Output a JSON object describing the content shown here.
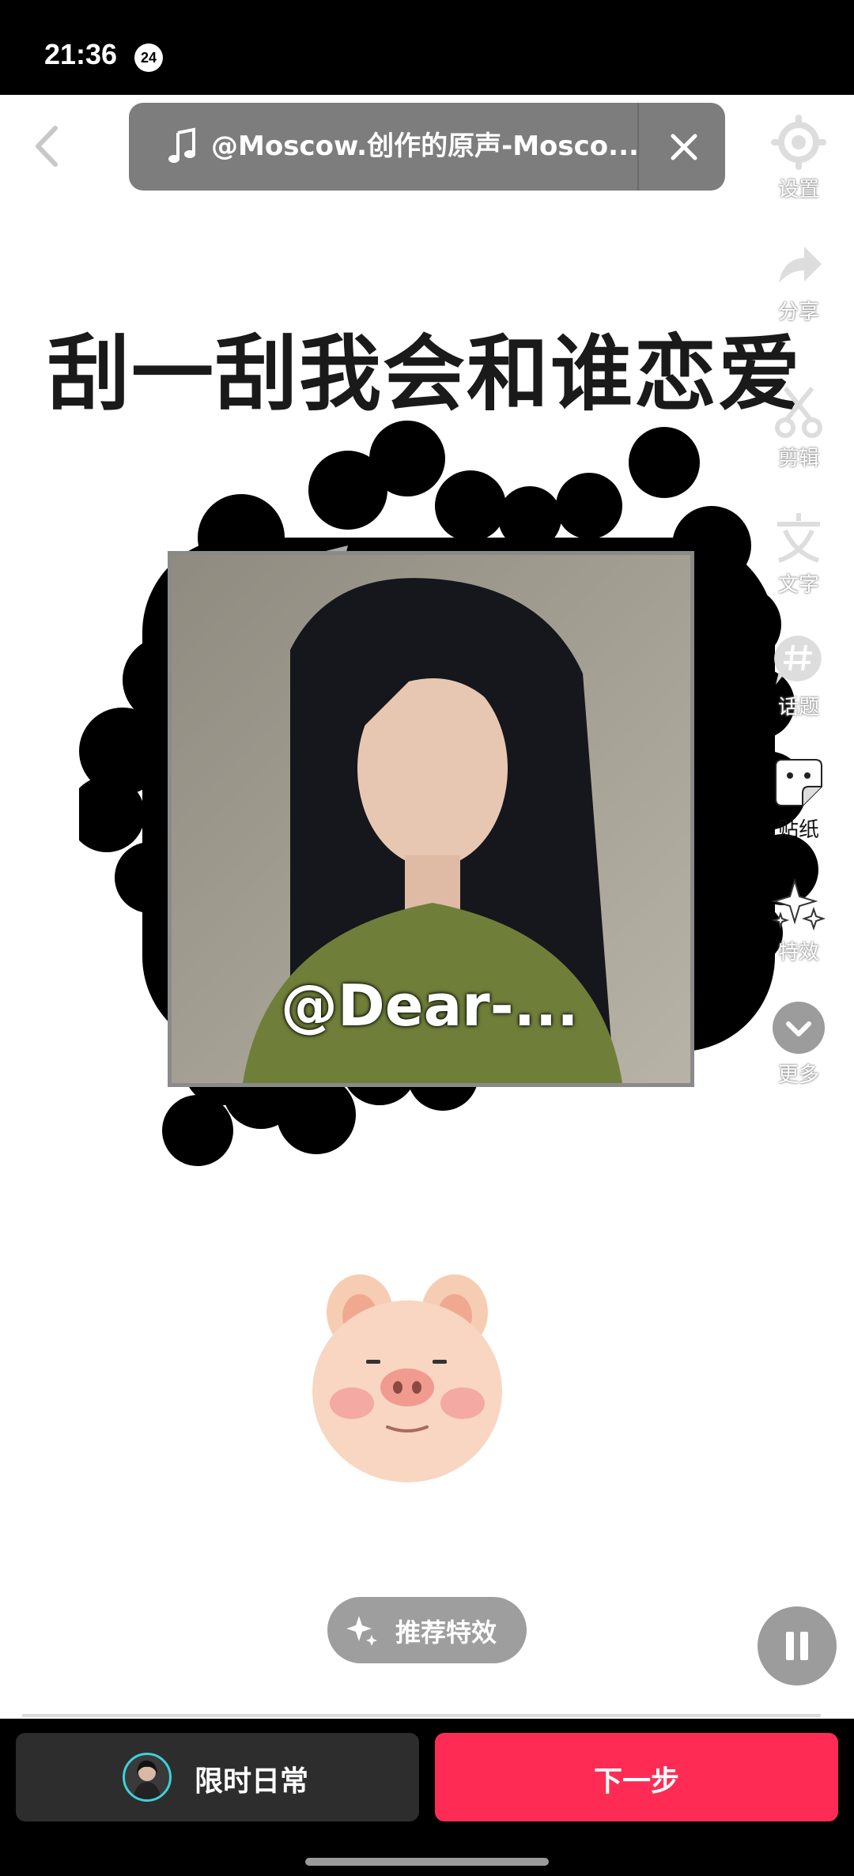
{
  "status_bar": {
    "time": "21:36",
    "badge": "24"
  },
  "music": {
    "title": "@Moscow.创作的原声-Mosco..."
  },
  "canvas": {
    "headline": "刮一刮我会和谁恋爱",
    "photo_caption": "@Dear-..."
  },
  "side_tools": [
    {
      "label": "设置",
      "icon": "gear-icon"
    },
    {
      "label": "分享",
      "icon": "share-icon"
    },
    {
      "label": "剪辑",
      "icon": "scissors-icon"
    },
    {
      "label": "文字",
      "icon": "text-icon"
    },
    {
      "label": "话题",
      "icon": "hashtag-icon"
    },
    {
      "label": "贴纸",
      "icon": "sticker-icon"
    },
    {
      "label": "特效",
      "icon": "sparkle-icon"
    },
    {
      "label": "更多",
      "icon": "chevron-down-icon"
    }
  ],
  "recommend": {
    "label": "推荐特效"
  },
  "bottom": {
    "daily_label": "限时日常",
    "next_label": "下一步"
  },
  "colors": {
    "accent": "#fe2c55",
    "pill_gray": "#7d7d7d",
    "ring": "#3fd0d8"
  }
}
